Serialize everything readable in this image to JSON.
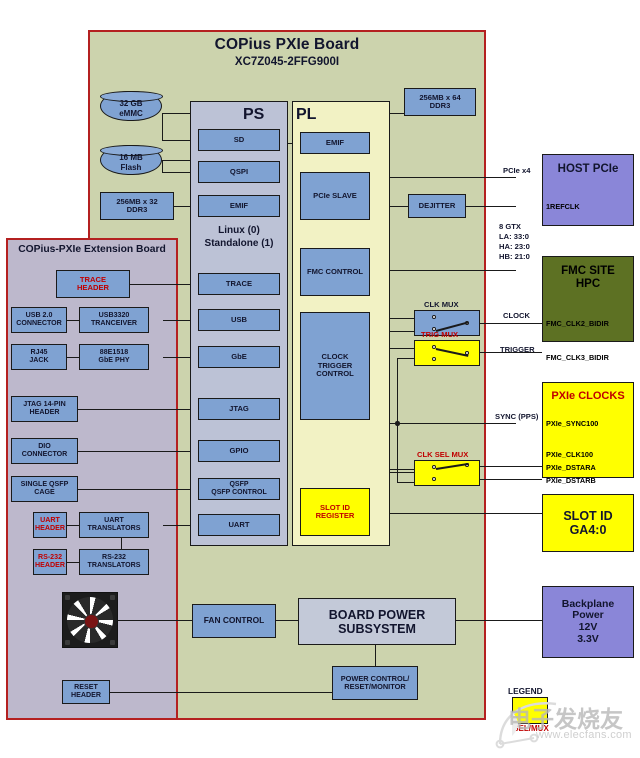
{
  "board": {
    "title": "COPius PXIe Board",
    "subtitle": "XC7Z045-2FFG900I",
    "ps_title": "PS",
    "pl_title": "PL",
    "os_label": "Linux (0)\nStandalone (1)"
  },
  "extension_board": {
    "title": "COPius-PXIe Extension Board"
  },
  "memories": [
    {
      "name": "emmc",
      "label": "32 GB\neMMC"
    },
    {
      "name": "flash",
      "label": "16 MB\nFlash"
    },
    {
      "name": "ps-ddr3",
      "label": "256MB x 32\nDDR3"
    },
    {
      "name": "pl-ddr3",
      "label": "256MB x 64\nDDR3"
    }
  ],
  "ps_blocks": [
    {
      "name": "sd",
      "label": "SD"
    },
    {
      "name": "qspi",
      "label": "QSPI"
    },
    {
      "name": "emif",
      "label": "EMIF"
    },
    {
      "name": "trace",
      "label": "TRACE"
    },
    {
      "name": "usb",
      "label": "USB"
    },
    {
      "name": "gbe",
      "label": "GbE"
    },
    {
      "name": "jtag",
      "label": "JTAG"
    },
    {
      "name": "gpio",
      "label": "GPIO"
    },
    {
      "name": "qsfp",
      "label": "QSFP\nQSFP CONTROL"
    },
    {
      "name": "uart",
      "label": "UART"
    }
  ],
  "pl_blocks": [
    {
      "name": "emif",
      "label": "EMIF"
    },
    {
      "name": "pcie-slave",
      "label": "PCIe SLAVE"
    },
    {
      "name": "fmc-control",
      "label": "FMC CONTROL"
    },
    {
      "name": "clock-trigger-control",
      "label": "CLOCK\nTRIGGER\nCONTROL"
    },
    {
      "name": "slot-id-register",
      "label": "SLOT ID\nREGISTER"
    }
  ],
  "extension_blocks": [
    {
      "name": "trace-header",
      "label": "TRACE\nHEADER"
    },
    {
      "name": "usb-connector",
      "label": "USB 2.0\nCONNECTOR"
    },
    {
      "name": "usb3320-tranceiver",
      "label": "USB3320\nTRANCEIVER"
    },
    {
      "name": "rj45-jack",
      "label": "RJ45\nJACK"
    },
    {
      "name": "gbe-phy",
      "label": "88E1518\nGbE PHY"
    },
    {
      "name": "jtag-header",
      "label": "JTAG 14-PIN\nHEADER"
    },
    {
      "name": "dio-connector",
      "label": "DIO\nCONNECTOR"
    },
    {
      "name": "qsfp-cage",
      "label": "SINGLE QSFP\nCAGE"
    },
    {
      "name": "uart-header",
      "label": "UART\nHEADER"
    },
    {
      "name": "uart-translators",
      "label": "UART\nTRANSLATORS"
    },
    {
      "name": "rs232-header",
      "label": "RS-232\nHEADER"
    },
    {
      "name": "rs232-translators",
      "label": "RS-232\nTRANSLATORS"
    },
    {
      "name": "reset-header",
      "label": "RESET\nHEADER"
    }
  ],
  "misc_blocks": [
    {
      "name": "dejitter",
      "label": "DEJITTER"
    },
    {
      "name": "fan-control",
      "label": "FAN CONTROL"
    },
    {
      "name": "board-power-subsystem",
      "label": "BOARD POWER\nSUBSYSTEM"
    },
    {
      "name": "power-control-reset-monitor",
      "label": "POWER CONTROL/\nRESET/MONITOR"
    }
  ],
  "muxes": [
    {
      "name": "clk-mux",
      "label": "CLK MUX",
      "color": "blue"
    },
    {
      "name": "trig-mux",
      "label": "TRIG MUX",
      "color": "yellow"
    },
    {
      "name": "clk-sel-mux",
      "label": "CLK SEL MUX",
      "color": "yellow"
    }
  ],
  "right_blocks": [
    {
      "name": "host-pcie",
      "label": "HOST PCIe",
      "color": "#8a86d8",
      "pins": [
        "1REFCLK"
      ]
    },
    {
      "name": "fmc-site-hpc",
      "label": "FMC SITE\nHPC",
      "color": "#5d7123",
      "pins": [
        "FMC_CLK2_BIDIR",
        "FMC_CLK3_BIDIR"
      ]
    },
    {
      "name": "pxie-clocks",
      "label": "PXIe CLOCKS",
      "color": "#ffff00",
      "pins": [
        "PXIe_SYNC100",
        "PXIe_CLK100",
        "PXIe_DSTARA",
        "PXIe_DSTARB"
      ]
    },
    {
      "name": "slot-id",
      "label": "SLOT ID\nGA4:0",
      "color": "#ffff00",
      "pins": []
    },
    {
      "name": "backplane-power",
      "label": "Backplane\nPower\n12V\n3.3V",
      "color": "#8a86d8",
      "pins": []
    }
  ],
  "signal_labels": [
    {
      "name": "pcie-x4",
      "text": "PCIe x4"
    },
    {
      "name": "gtx-fmc",
      "text": "8 GTX\nLA: 33:0\nHA: 23:0\nHB: 21:0"
    },
    {
      "name": "clock",
      "text": "CLOCK"
    },
    {
      "name": "trigger",
      "text": "TRIGGER"
    },
    {
      "name": "sync-pps",
      "text": "SYNC (PPS)"
    }
  ],
  "legend": {
    "title": "LEGEND",
    "caption": "SEL/MUX"
  },
  "watermark": {
    "text": "电子发烧友",
    "sub": "www.elecfans.com"
  },
  "colors": {
    "board_bg": "#ccd3ad",
    "extension_bg": "#bdb8cc",
    "border_red": "#b42020",
    "block_blue": "#7fa2d2",
    "block_yellow": "#ffff00",
    "block_purple": "#8a86d8",
    "block_olive": "#5d7123",
    "ps_col": "#bcc2d6",
    "pl_col": "#f2f2c4"
  }
}
